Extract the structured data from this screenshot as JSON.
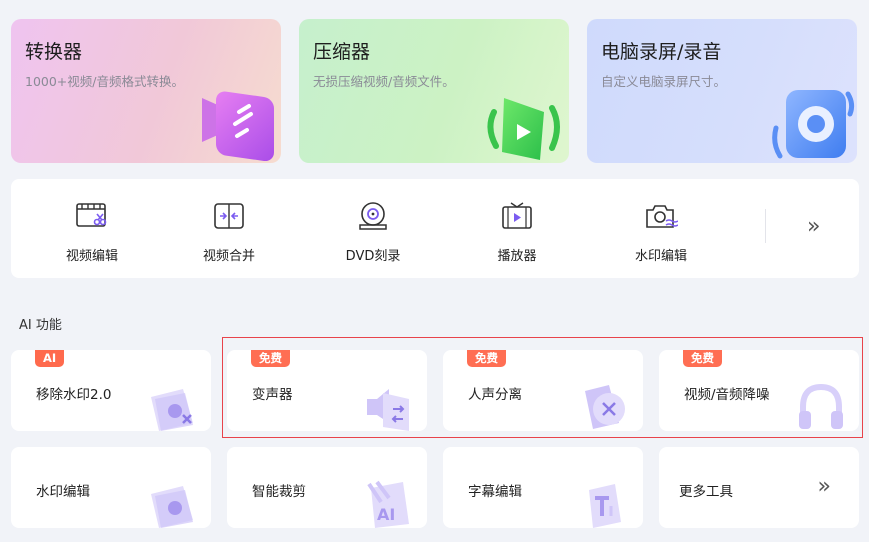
{
  "hero": [
    {
      "title": "转换器",
      "subtitle": "1000+视频/音频格式转换。"
    },
    {
      "title": "压缩器",
      "subtitle": "无损压缩视频/音频文件。"
    },
    {
      "title": "电脑录屏/录音",
      "subtitle": "自定义电脑录屏尺寸。"
    }
  ],
  "tools": [
    {
      "label": "视频编辑",
      "icon": "video-edit-icon"
    },
    {
      "label": "视频合并",
      "icon": "video-merge-icon"
    },
    {
      "label": "DVD刻录",
      "icon": "dvd-icon"
    },
    {
      "label": "播放器",
      "icon": "player-icon"
    },
    {
      "label": "水印编辑",
      "icon": "watermark-icon"
    }
  ],
  "tools_more": "»",
  "ai_section": {
    "title": "AI 功能"
  },
  "ai_cards": [
    {
      "label": "移除水印2.0",
      "badge": "AI"
    },
    {
      "label": "变声器",
      "badge": "免费"
    },
    {
      "label": "人声分离",
      "badge": "免费"
    },
    {
      "label": "视频/音频降噪",
      "badge": "免费"
    }
  ],
  "more_cards": [
    {
      "label": "水印编辑"
    },
    {
      "label": "智能裁剪"
    },
    {
      "label": "字幕编辑"
    },
    {
      "label": "更多工具",
      "more": "»"
    }
  ],
  "colors": {
    "accent": "#7b5cf0",
    "badge": "#ff6a4d",
    "highlight": "#e8434b"
  }
}
